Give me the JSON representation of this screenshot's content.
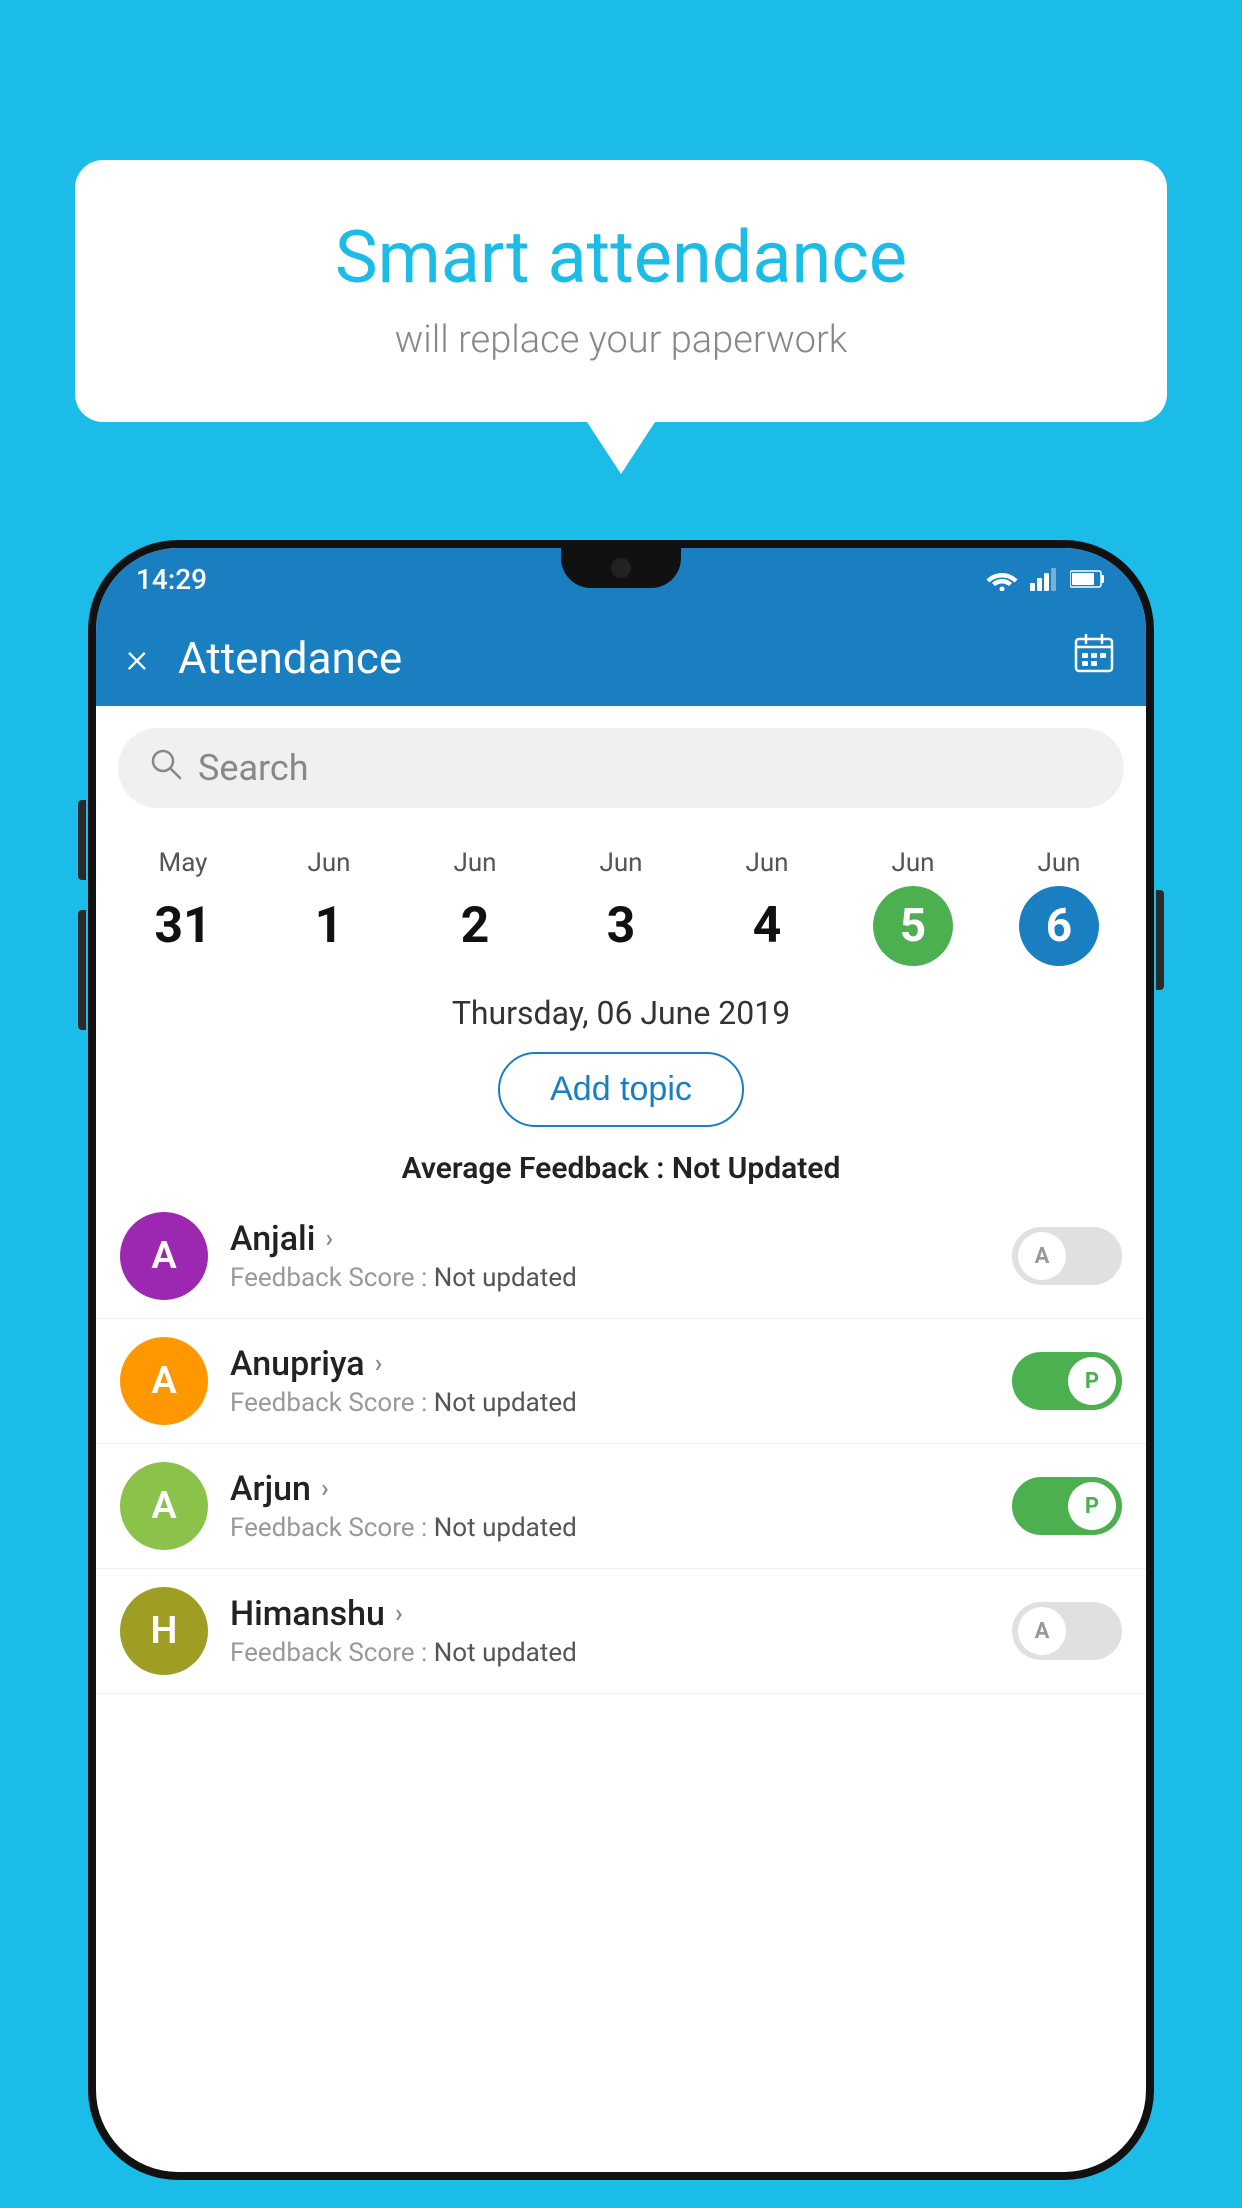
{
  "background_color": "#1BBDE8",
  "speech_bubble": {
    "title": "Smart attendance",
    "subtitle": "will replace your paperwork"
  },
  "status_bar": {
    "time": "14:29",
    "icons": [
      "wifi",
      "signal",
      "battery"
    ]
  },
  "app_bar": {
    "close_label": "×",
    "title": "Attendance",
    "calendar_icon": "📅"
  },
  "search": {
    "placeholder": "Search"
  },
  "calendar": {
    "days": [
      {
        "month": "May",
        "date": "31",
        "style": "normal"
      },
      {
        "month": "Jun",
        "date": "1",
        "style": "normal"
      },
      {
        "month": "Jun",
        "date": "2",
        "style": "normal"
      },
      {
        "month": "Jun",
        "date": "3",
        "style": "normal"
      },
      {
        "month": "Jun",
        "date": "4",
        "style": "normal"
      },
      {
        "month": "Jun",
        "date": "5",
        "style": "today"
      },
      {
        "month": "Jun",
        "date": "6",
        "style": "selected"
      }
    ]
  },
  "selected_date": "Thursday, 06 June 2019",
  "add_topic_label": "Add topic",
  "avg_feedback_label": "Average Feedback :",
  "avg_feedback_value": "Not Updated",
  "students": [
    {
      "name": "Anjali",
      "avatar_letter": "A",
      "avatar_color": "purple",
      "feedback_label": "Feedback Score :",
      "feedback_value": "Not updated",
      "toggle": "off",
      "toggle_letter": "A"
    },
    {
      "name": "Anupriya",
      "avatar_letter": "A",
      "avatar_color": "orange",
      "feedback_label": "Feedback Score :",
      "feedback_value": "Not updated",
      "toggle": "on",
      "toggle_letter": "P"
    },
    {
      "name": "Arjun",
      "avatar_letter": "A",
      "avatar_color": "green",
      "feedback_label": "Feedback Score :",
      "feedback_value": "Not updated",
      "toggle": "on",
      "toggle_letter": "P"
    },
    {
      "name": "Himanshu",
      "avatar_letter": "H",
      "avatar_color": "olive",
      "feedback_label": "Feedback Score :",
      "feedback_value": "Not updated",
      "toggle": "off",
      "toggle_letter": "A"
    }
  ]
}
